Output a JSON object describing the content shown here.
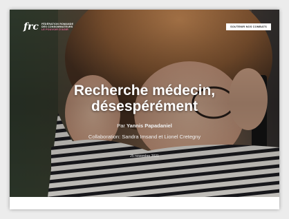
{
  "header": {
    "logo_mark": "frc",
    "logo_lines": [
      "FÉDÉRATION ROMANDE",
      "DES CONSOMMATEURS"
    ],
    "logo_tagline": "LE POUVOIR D'AGIR",
    "support_button": "SOUTENIR NOS COMBATS"
  },
  "article": {
    "title_line1": "Recherche médecin,",
    "title_line2": "désespérément",
    "by_prefix": "Par",
    "author": "Yannis Papadaniel",
    "collaboration": "Collaboration: Sandra Imsand et Lionel Cretegny",
    "date": "25 novembre 2021"
  },
  "colors": {
    "accent": "#e86a9a",
    "text_on_hero": "#ffffff"
  }
}
